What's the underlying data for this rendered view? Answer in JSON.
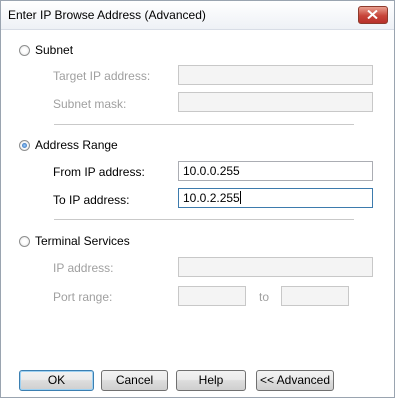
{
  "window": {
    "title": "Enter IP Browse Address (Advanced)",
    "close_icon": "close-icon"
  },
  "subnet": {
    "label": "Subnet",
    "selected": false,
    "target_label": "Target IP address:",
    "target_value": "",
    "mask_label": "Subnet mask:",
    "mask_value": ""
  },
  "address_range": {
    "label": "Address Range",
    "selected": true,
    "from_label": "From IP address:",
    "from_value": "10.0.0.255",
    "to_label": "To IP address:",
    "to_value": "10.0.2.255"
  },
  "terminal_services": {
    "label": "Terminal Services",
    "selected": false,
    "ip_label": "IP address:",
    "ip_value": "",
    "port_label": "Port range:",
    "port_from": "",
    "port_to_label": "to",
    "port_to": ""
  },
  "buttons": {
    "ok": "OK",
    "cancel": "Cancel",
    "help": "Help",
    "advanced": "<< Advanced"
  },
  "colors": {
    "close_button": "#c7453a",
    "focus_border": "#3d7bad",
    "default_button_border": "#3c7fb1"
  }
}
